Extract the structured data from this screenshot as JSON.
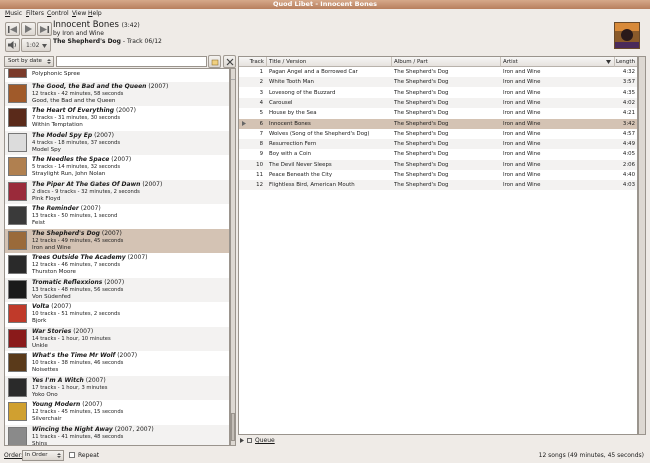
{
  "window": {
    "title": "Quod Libet - Innocent Bones"
  },
  "menu": [
    {
      "first": "M",
      "rest": "usic"
    },
    {
      "first": "F",
      "rest": "ilters"
    },
    {
      "first": "C",
      "rest": "ontrol"
    },
    {
      "first": "V",
      "rest": "iew"
    },
    {
      "first": "H",
      "rest": "elp"
    }
  ],
  "player": {
    "time": "1:02",
    "title": "Innocent Bones",
    "duration": "(3:42)",
    "byline": "by Iron and Wine",
    "album": "The Shepherd's Dog",
    "track_info": " - Track 06/12"
  },
  "browser": {
    "sort": "Sort by date",
    "search_value": ""
  },
  "albums": [
    {
      "title": "",
      "year": "",
      "meta": "",
      "artist": "Polyphonic Spree",
      "color": "#7a3a2a"
    },
    {
      "title": "The Good, the Bad and the Queen",
      "year": "(2007)",
      "meta": "12 tracks - 42 minutes, 58 seconds",
      "artist": "Good, the Bad and the Queen",
      "color": "#a05a2a"
    },
    {
      "title": "The Heart Of Everything",
      "year": "(2007)",
      "meta": "7 tracks - 31 minutes, 30 seconds",
      "artist": "Within Temptation",
      "color": "#5a2a1a"
    },
    {
      "title": "The Model Spy Ep",
      "year": "(2007)",
      "meta": "4 tracks - 18 minutes, 37 seconds",
      "artist": "Model Spy",
      "color": "#dcdcdc"
    },
    {
      "title": "The Needles the Space",
      "year": "(2007)",
      "meta": "5 tracks - 14 minutes, 32 seconds",
      "artist": "Straylight Run, John Nolan",
      "color": "#b08050"
    },
    {
      "title": "The Piper At The Gates Of Dawn",
      "year": "(2007)",
      "meta": "2 discs - 9 tracks - 32 minutes, 2 seconds",
      "artist": "Pink Floyd",
      "color": "#9a2a3a"
    },
    {
      "title": "The Reminder",
      "year": "(2007)",
      "meta": "13 tracks - 50 minutes, 1 second",
      "artist": "Feist",
      "color": "#3a3a3a"
    },
    {
      "title": "The Shepherd's Dog",
      "year": "(2007)",
      "meta": "12 tracks - 49 minutes, 45 seconds",
      "artist": "Iron and Wine",
      "color": "#9a6a3a"
    },
    {
      "title": "Trees Outside The Academy",
      "year": "(2007)",
      "meta": "12 tracks - 46 minutes, 7 seconds",
      "artist": "Thurston Moore",
      "color": "#2a2a2a"
    },
    {
      "title": "Tromatic Reflexxions",
      "year": "(2007)",
      "meta": "13 tracks - 48 minutes, 56 seconds",
      "artist": "Von Südenfed",
      "color": "#1a1a1a"
    },
    {
      "title": "Volta",
      "year": "(2007)",
      "meta": "10 tracks - 51 minutes, 2 seconds",
      "artist": "Bjork",
      "color": "#c03a2a"
    },
    {
      "title": "War Stories",
      "year": "(2007)",
      "meta": "14 tracks - 1 hour, 10 minutes",
      "artist": "Unkle",
      "color": "#8a1a1a"
    },
    {
      "title": "What's the Time Mr Wolf",
      "year": "(2007)",
      "meta": "10 tracks - 38 minutes, 46 seconds",
      "artist": "Noisettes",
      "color": "#5a3a1a"
    },
    {
      "title": "Yes I'm A Witch",
      "year": "(2007)",
      "meta": "17 tracks - 1 hour, 3 minutes",
      "artist": "Yoko Ono",
      "color": "#2a2a2a"
    },
    {
      "title": "Young Modern",
      "year": "(2007)",
      "meta": "12 tracks - 45 minutes, 15 seconds",
      "artist": "Silverchair",
      "color": "#d0a030"
    },
    {
      "title": "Wincing the Night Away",
      "year": "(2007, 2007)",
      "meta": "11 tracks - 41 minutes, 48 seconds",
      "artist": "Shins",
      "color": "#8a8a8a"
    }
  ],
  "columns": {
    "track": "Track",
    "title": "Title / Version",
    "album": "Album / Part",
    "artist": "Artist",
    "length": "Length"
  },
  "songs": [
    {
      "track": "1",
      "title": "Pagan Angel and a Borrowed Car",
      "album": "The Shepherd's Dog",
      "artist": "Iron and Wine",
      "length": "4:32"
    },
    {
      "track": "2",
      "title": "White Tooth Man",
      "album": "The Shepherd's Dog",
      "artist": "Iron and Wine",
      "length": "3:57"
    },
    {
      "track": "3",
      "title": "Lovesong of the Buzzard",
      "album": "The Shepherd's Dog",
      "artist": "Iron and Wine",
      "length": "4:35"
    },
    {
      "track": "4",
      "title": "Carousel",
      "album": "The Shepherd's Dog",
      "artist": "Iron and Wine",
      "length": "4:02"
    },
    {
      "track": "5",
      "title": "House by the Sea",
      "album": "The Shepherd's Dog",
      "artist": "Iron and Wine",
      "length": "4:21"
    },
    {
      "track": "6",
      "title": "Innocent Bones",
      "album": "The Shepherd's Dog",
      "artist": "Iron and Wine",
      "length": "3:42"
    },
    {
      "track": "7",
      "title": "Wolves (Song of the Shepherd's Dog)",
      "album": "The Shepherd's Dog",
      "artist": "Iron and Wine",
      "length": "4:57"
    },
    {
      "track": "8",
      "title": "Resurrection Fern",
      "album": "The Shepherd's Dog",
      "artist": "Iron and Wine",
      "length": "4:49"
    },
    {
      "track": "9",
      "title": "Boy with a Coin",
      "album": "The Shepherd's Dog",
      "artist": "Iron and Wine",
      "length": "4:05"
    },
    {
      "track": "10",
      "title": "The Devil Never Sleeps",
      "album": "The Shepherd's Dog",
      "artist": "Iron and Wine",
      "length": "2:06"
    },
    {
      "track": "11",
      "title": "Peace Beneath the City",
      "album": "The Shepherd's Dog",
      "artist": "Iron and Wine",
      "length": "4:40"
    },
    {
      "track": "12",
      "title": "Flightless Bird, American Mouth",
      "album": "The Shepherd's Dog",
      "artist": "Iron and Wine",
      "length": "4:03"
    }
  ],
  "playing_index": 5,
  "queue": {
    "label": "Queue"
  },
  "status": {
    "order_label": "Order:",
    "order_value": "In Order",
    "repeat_label": "Repeat",
    "summary": "12 songs (49 minutes, 45 seconds)"
  }
}
